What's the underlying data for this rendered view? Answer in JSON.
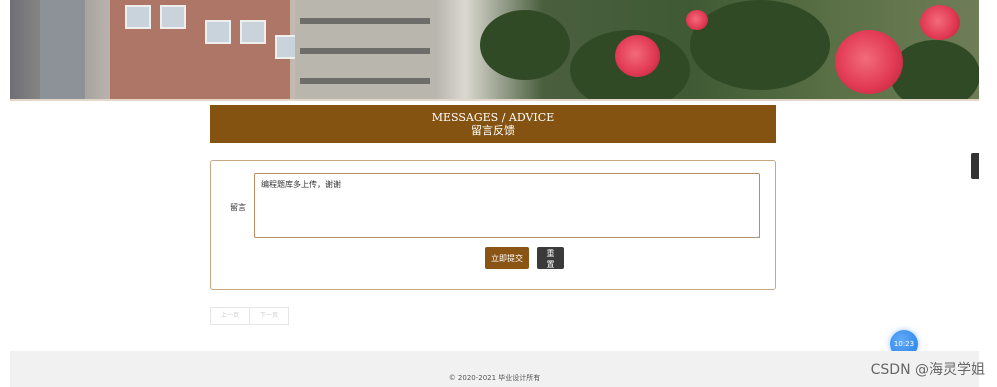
{
  "header": {
    "title_en": "MESSAGES / ADVICE",
    "title_zh": "留言反馈"
  },
  "form": {
    "message_label": "留言",
    "message_value": "编程题库多上传，谢谢",
    "submit_label": "立即提交",
    "reset_label": "重置"
  },
  "pagination": {
    "prev_label": "上一页",
    "next_label": "下一页"
  },
  "overlay": {
    "time": "10:23"
  },
  "footer": {
    "copyright": "© 2020-2021 毕业设计所有"
  },
  "watermark": "CSDN @海灵学姐",
  "colors": {
    "brand_brown": "#855311",
    "reset_dark": "#3a3a3a",
    "footer_bg": "#f1f1f1"
  }
}
